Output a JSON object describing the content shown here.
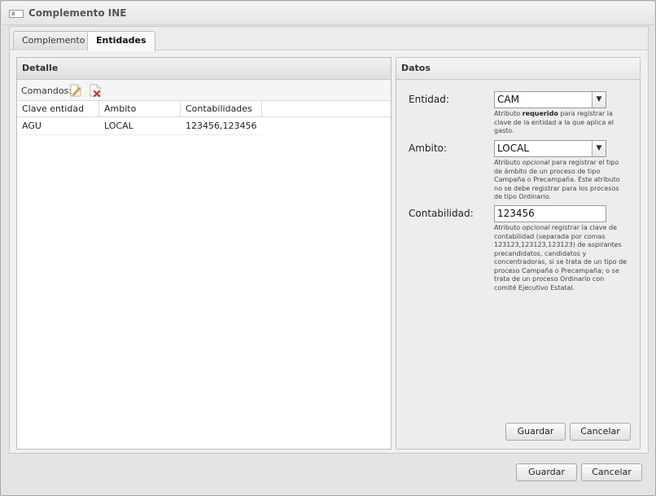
{
  "window": {
    "title": "Complemento INE",
    "icon_glyph": "x"
  },
  "tabs": [
    {
      "label": "Complemento",
      "active": false
    },
    {
      "label": "Entidades",
      "active": true
    }
  ],
  "left_panel": {
    "title": "Detalle",
    "toolbar_label": "Comandos:",
    "toolbar_icons": [
      "edit-icon",
      "delete-icon"
    ],
    "columns": [
      "Clave entidad",
      "Ambito",
      "Contabilidades"
    ],
    "rows": [
      {
        "clave": "AGU",
        "ambito": "LOCAL",
        "contabilidades": "123456,123456"
      }
    ]
  },
  "right_panel": {
    "title": "Datos",
    "entidad": {
      "label": "Entidad:",
      "value": "CAM",
      "help_pre": "Atributo ",
      "help_strong": "requerido",
      "help_post": " para registrar la clave de la entidad a la que aplica el gasto."
    },
    "ambito": {
      "label": "Ambito:",
      "value": "LOCAL",
      "help_pre": "Atributo ",
      "help_em": "opcional",
      "help_post": " para registrar el tipo de ámbito de un proceso de tipo Campaña o Precampaña. Este atributo no se debe registrar para los procesos de tipo Ordinario."
    },
    "contabilidad": {
      "label": "Contabilidad:",
      "value": "123456",
      "help_pre": "Atributo ",
      "help_em": "opcional",
      "help_post": " registrar la clave de contabilidad (separada por comas 123123,123123,123123) de aspirantes precandidatos, candidatos y concentradoras, si se trata de un tipo de proceso Campaña o Precampaña; o se trata de un proceso Ordinario con comité Ejecutivo Estatal."
    },
    "buttons": {
      "save": "Guardar",
      "cancel": "Cancelar"
    }
  },
  "footer": {
    "save": "Guardar",
    "cancel": "Cancelar"
  },
  "colors": {
    "window_bg": "#e4e4e4",
    "panel_bg": "#ffffff",
    "border": "#bcbcbc",
    "delete_icon_red": "#d0312d"
  }
}
